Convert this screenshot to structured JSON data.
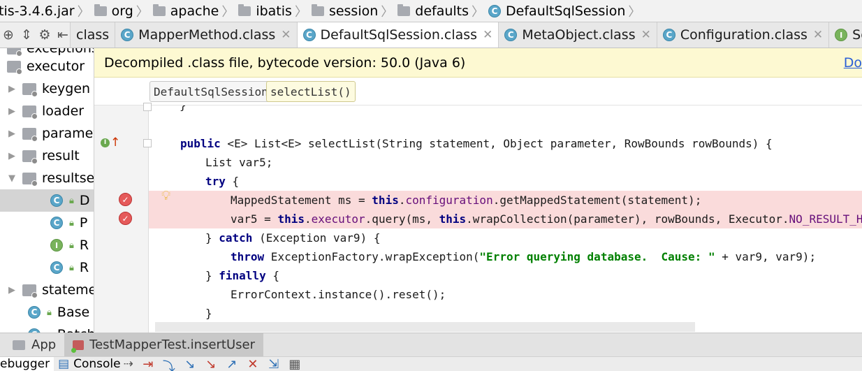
{
  "navbar": {
    "crumbs": [
      {
        "label": "tis-3.4.6.jar",
        "icon": "jar"
      },
      {
        "label": "org",
        "icon": "folder-icon"
      },
      {
        "label": "apache",
        "icon": "folder-icon"
      },
      {
        "label": "ibatis",
        "icon": "folder-icon"
      },
      {
        "label": "session",
        "icon": "folder-icon"
      },
      {
        "label": "defaults",
        "icon": "folder-icon"
      },
      {
        "label": "DefaultSqlSession",
        "icon": "class-icon"
      }
    ]
  },
  "tabs": [
    {
      "label": "class"
    },
    {
      "label": "MapperMethod.class"
    },
    {
      "label": "DefaultSqlSession.class"
    },
    {
      "label": "MetaObject.class"
    },
    {
      "label": "Configuration.class"
    },
    {
      "label": "SqlS"
    }
  ],
  "tree": {
    "items": [
      {
        "label": "exceptions"
      },
      {
        "label": "executor"
      },
      {
        "label": "keygen"
      },
      {
        "label": "loader"
      },
      {
        "label": "paramete"
      },
      {
        "label": "result"
      },
      {
        "label": "resultse"
      },
      {
        "label": "D"
      },
      {
        "label": "P"
      },
      {
        "label": "R"
      },
      {
        "label": "R"
      },
      {
        "label": "stateme"
      },
      {
        "label": "Base"
      },
      {
        "label": "Batch"
      }
    ]
  },
  "banner": {
    "text": "Decompiled .class file, bytecode version: 50.0 (Java 6)",
    "link": "Do"
  },
  "editor_breadcrumb": {
    "class_chip": "DefaultSqlSession",
    "method_chip": "selectList()"
  },
  "code": {
    "l0": "}",
    "l2_kw": "public",
    "l2_rest": " <E> List<E> selectList(String statement, Object parameter, RowBounds rowBounds) {",
    "l3": "List var5;",
    "l4_kw": "try",
    "l4_rest": " {",
    "l5_a": "MappedStatement ms = ",
    "l5_kw": "this",
    "l5_b": ".",
    "l5_fld": "configuration",
    "l5_c": ".getMappedStatement(statement);",
    "l6_a": "var5 = ",
    "l6_kw1": "this",
    "l6_b": ".",
    "l6_fld": "executor",
    "l6_c": ".query(ms, ",
    "l6_kw2": "this",
    "l6_d": ".wrapCollection(parameter), rowBounds, Executor.",
    "l6_fld2": "NO_RESULT_HANDLER",
    "l6_e": ");",
    "l7_a": "} ",
    "l7_kw": "catch",
    "l7_b": " (Exception var9) {",
    "l8_kw": "throw",
    "l8_a": " ExceptionFactory.wrapException(",
    "l8_str": "\"Error querying database.  Cause: \"",
    "l8_b": " + var9, var9);",
    "l9_a": "} ",
    "l9_kw": "finally",
    "l9_b": " {",
    "l10": "ErrorContext.instance().reset();",
    "l11": "}"
  },
  "run_tabs": [
    {
      "label": "App"
    },
    {
      "label": "TestMapperTest.insertUser"
    }
  ],
  "debugger": {
    "debugger_tab": "ebugger",
    "console_tab": "Console"
  }
}
